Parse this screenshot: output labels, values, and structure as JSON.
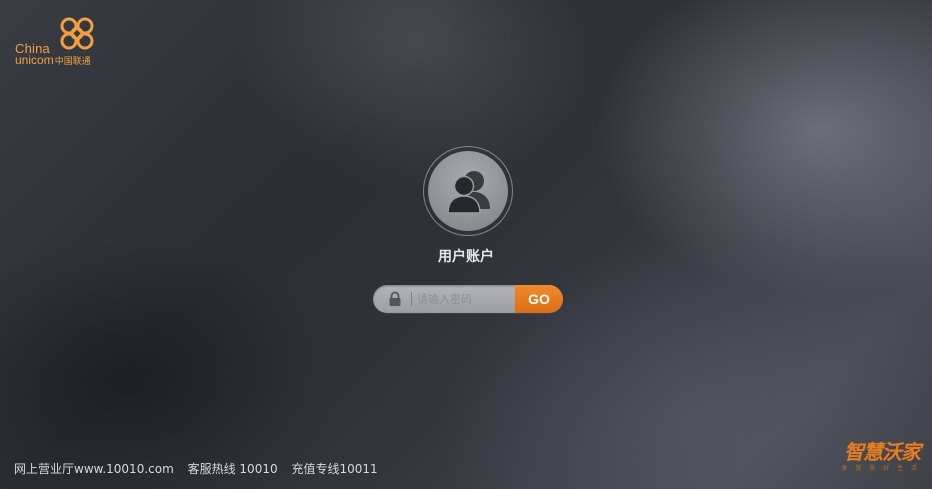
{
  "logo": {
    "line1": "China",
    "line2": "unicom",
    "line2_cn": "中国联通"
  },
  "account": {
    "title": "用户账户"
  },
  "login": {
    "password_placeholder": "请输入密码",
    "go_label": "GO"
  },
  "footer": {
    "website": "网上营业厅www.10010.com",
    "hotline": "客服热线 10010",
    "recharge": "充值专线10011"
  },
  "brand": {
    "name": "智慧沃家",
    "slogan": "享 受 美 好 生 活"
  },
  "colors": {
    "accent": "#e87d1e",
    "logo": "#f0a040",
    "go_button": "#dc6d14"
  },
  "icons": [
    "china-unicom-knot-icon",
    "users-icon",
    "lock-icon"
  ]
}
